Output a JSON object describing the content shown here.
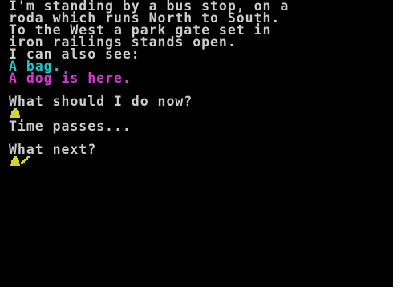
{
  "game": {
    "description": [
      "I'm standing by a bus stop, on a",
      "roda which runs North to South.",
      "To the West a park gate set in",
      "iron railings stands open.",
      "I can also see:"
    ],
    "items": [
      {
        "text": "A bag.",
        "color": "#1fc8c8"
      },
      {
        "text": "A dog is here.",
        "color": "#d23ad2"
      }
    ],
    "prompt_1": "What should I do now?",
    "response_1": "Time passes...",
    "prompt_2": "What next?",
    "text_color": "#cdcdcd",
    "cursor_color": "#d2d22a",
    "icons": {
      "input_marker": "bell-icon",
      "input_cursor": "pen-cursor-icon"
    }
  }
}
